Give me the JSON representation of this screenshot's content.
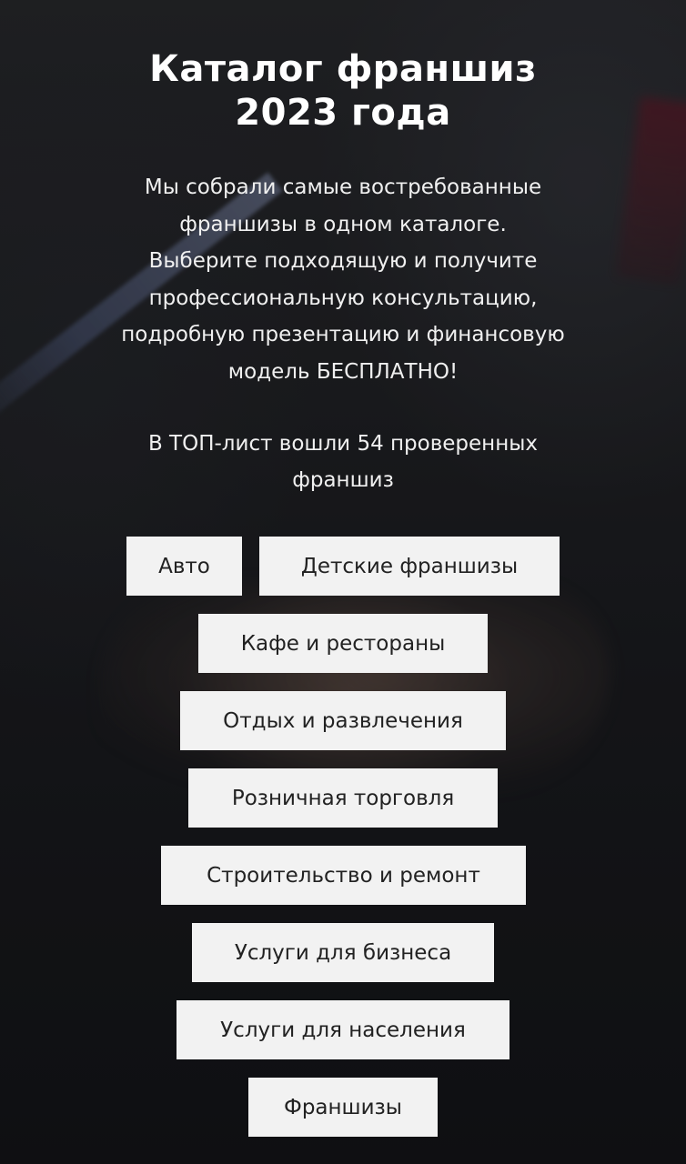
{
  "header": {
    "title_lines": [
      "Каталог франшиз",
      "2023 года"
    ]
  },
  "intro": {
    "description_lines": [
      "Мы собрали самые востребованные",
      "франшизы в одном каталоге.",
      "Выберите подходящую и получите",
      "профессиональную консультацию,",
      "подробную презентацию и финансовую",
      "модель БЕСПЛАТНО!"
    ],
    "top_note_lines": [
      "В ТОП-лист вошли 54 проверенных",
      "франшиз"
    ]
  },
  "categories": [
    "Авто",
    "Детские франшизы",
    "Кафе и рестораны",
    "Отдых и развлечения",
    "Розничная торговля",
    "Строительство и ремонт",
    "Услуги для бизнеса",
    "Услуги для населения",
    "Франшизы"
  ],
  "colors": {
    "button_bg": "#f2f2f2",
    "button_text": "#222222",
    "heading_text": "#ffffff"
  }
}
